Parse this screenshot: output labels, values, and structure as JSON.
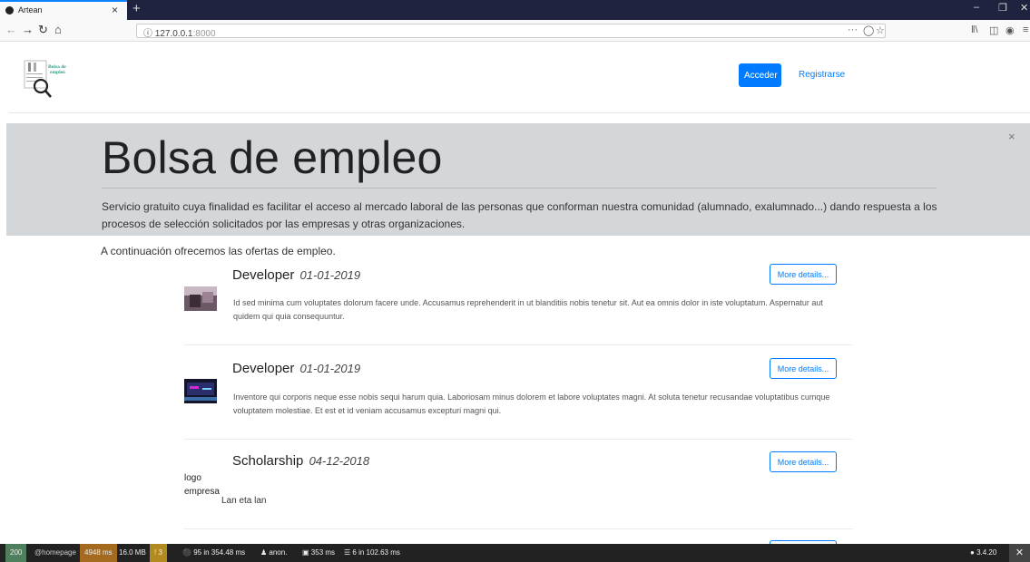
{
  "browser": {
    "tab_title": "Artean",
    "tab_close": "×",
    "new_tab": "+",
    "url_host": "127.0.0.1",
    "url_port": ":8000",
    "url_info_icon": "ⓘ",
    "page_actions": "···",
    "win_min": "–",
    "win_max": "❐",
    "win_close": "✕"
  },
  "site": {
    "logo_text": "Bolsa de empleo",
    "login_label": "Acceder",
    "register_label": "Registrarse"
  },
  "jumbotron": {
    "close": "×",
    "title": "Bolsa de empleo",
    "lead": "Servicio gratuito cuya finalidad es facilitar el acceso al mercado laboral de las personas que conforman nuestra comunidad (alumnado, exalumnado...) dando respuesta a los procesos de selección solicitados por las empresas y otras organizaciones."
  },
  "intro_text": "A continuación ofrecemos las ofertas de empleo.",
  "offers": [
    {
      "title": "Developer",
      "date": "01-01-2019",
      "button": "More details...",
      "description": "Id sed minima cum voluptates dolorum facere unde. Accusamus reprehenderit in ut blanditiis nobis tenetur sit. Aut ea omnis dolor in iste voluptatum. Aspernatur aut quidem qui quia consequuntur."
    },
    {
      "title": "Developer",
      "date": "01-01-2019",
      "button": "More details...",
      "description": "Inventore qui corporis neque esse nobis sequi harum quia. Laboriosam minus dolorem et labore voluptates magni. At soluta tenetur recusandae voluptatibus cumque voluptatem molestiae. Et est et id veniam accusamus excepturi magni qui."
    },
    {
      "title": "Scholarship",
      "date": "04-12-2018",
      "button": "More details...",
      "logo_alt": "logo empresa",
      "description": "Lan eta lan"
    }
  ],
  "debug_toolbar": {
    "status": "200",
    "route": "@homepage",
    "time": "4948 ms",
    "memory": "16.0 MB",
    "log_count": "3",
    "cache": "95 in 354.48 ms",
    "user": "anon.",
    "twig": "353 ms",
    "db": "6 in 102.63 ms",
    "version": "3.4.20",
    "close": "✕",
    "colors": {
      "status": "#4f805d",
      "time": "#a46a1f",
      "log": "#b38a1f"
    }
  }
}
